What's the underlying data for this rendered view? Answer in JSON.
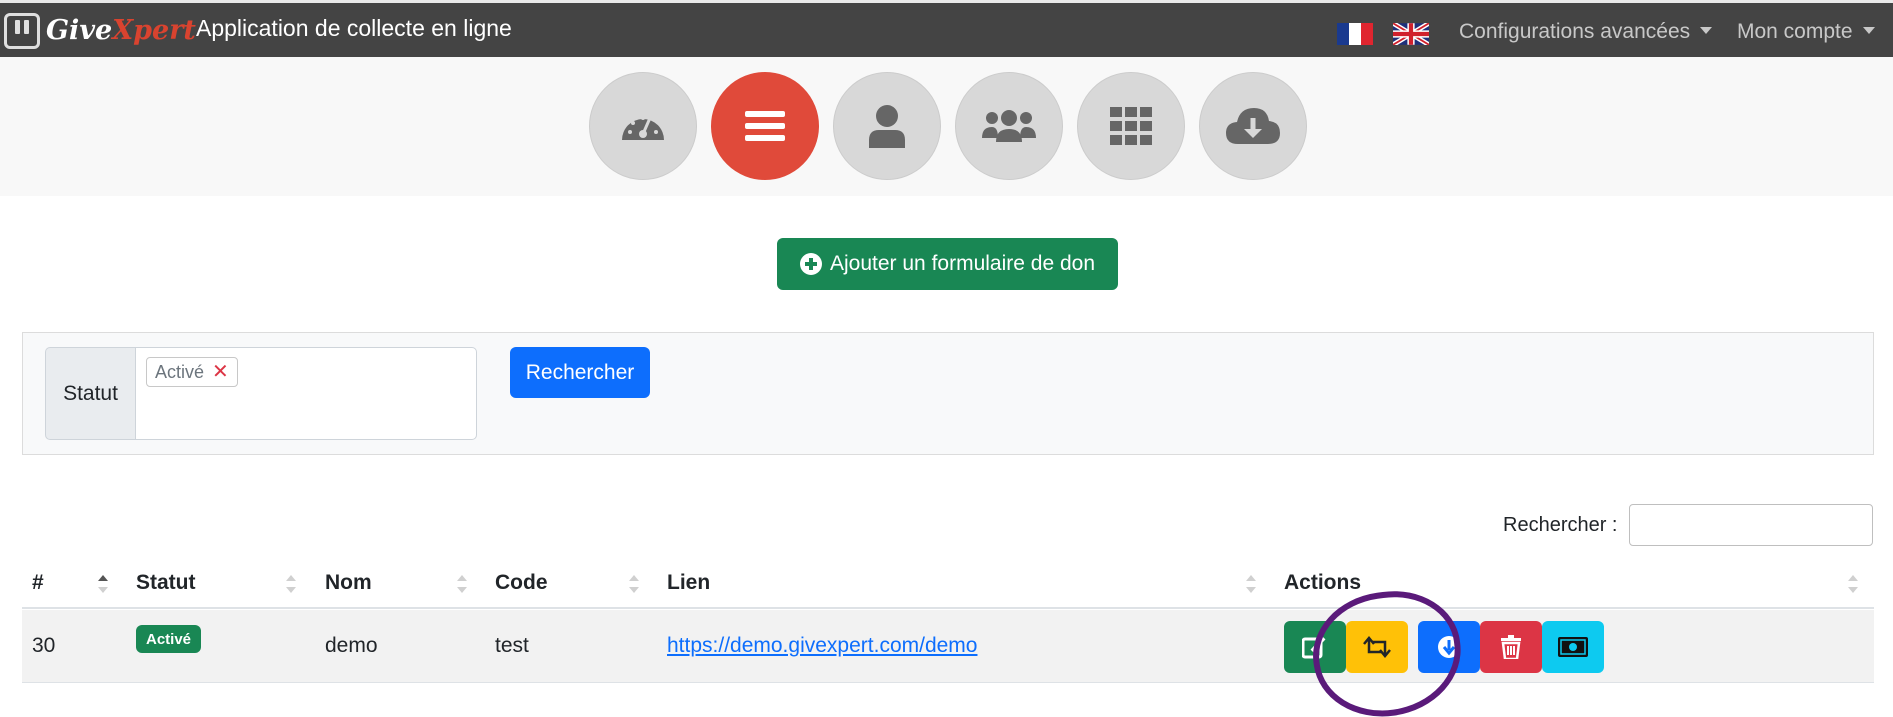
{
  "navbar": {
    "brand_give": "Give",
    "brand_xpert": "Xpert",
    "app_title": "Application de collecte en ligne",
    "config_menu": "Configurations avancées",
    "account_menu": "Mon compte",
    "colors": {
      "background": "#444444",
      "brand_accent": "#d9432f"
    }
  },
  "iconbar": {
    "items": [
      {
        "icon": "dashboard-gauge-icon",
        "active": false
      },
      {
        "icon": "menu-list-icon",
        "active": true
      },
      {
        "icon": "user-icon",
        "active": false
      },
      {
        "icon": "users-group-icon",
        "active": false
      },
      {
        "icon": "grid-icon",
        "active": false
      },
      {
        "icon": "cloud-download-icon",
        "active": false
      }
    ],
    "active_color": "#e04a3a"
  },
  "add_button": {
    "label": "Ajouter un formulaire de don"
  },
  "filter": {
    "status_label": "Statut",
    "selected_tag": "Activé",
    "search_button": "Rechercher"
  },
  "table_search": {
    "label": "Rechercher :",
    "value": ""
  },
  "table": {
    "columns": [
      "#",
      "Statut",
      "Nom",
      "Code",
      "Lien",
      "Actions"
    ],
    "rows": [
      {
        "id": "30",
        "status": "Activé",
        "name": "demo",
        "code": "test",
        "link": "https://demo.givexpert.com/demo"
      }
    ],
    "action_colors": {
      "edit": "#198754",
      "duplicate": "#ffc107",
      "download": "#0d6efd",
      "delete": "#dc3545",
      "payment": "#0dcaf0"
    }
  }
}
